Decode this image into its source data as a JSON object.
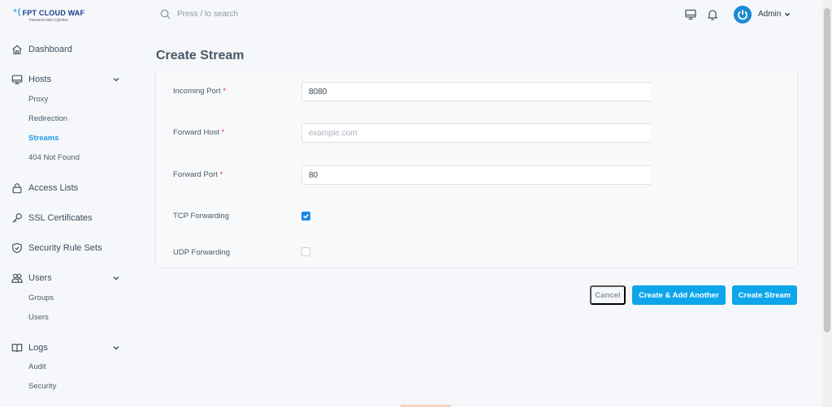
{
  "brand": {
    "name": "FPT CLOUD  WAF",
    "tagline": "Partnered with Cyberlex"
  },
  "header": {
    "search_placeholder": "Press / to search",
    "user_name": "Admin"
  },
  "sidebar": {
    "dashboard": "Dashboard",
    "hosts": {
      "label": "Hosts",
      "items": [
        "Proxy",
        "Redirection",
        "Streams",
        "404 Not Found"
      ]
    },
    "access_lists": "Access Lists",
    "ssl": "SSL Certificates",
    "security_rules": "Security Rule Sets",
    "users": {
      "label": "Users",
      "items": [
        "Groups",
        "Users"
      ]
    },
    "logs": {
      "label": "Logs",
      "items": [
        "Audit",
        "Security"
      ]
    }
  },
  "page": {
    "title": "Create Stream"
  },
  "form": {
    "incoming_port": {
      "label": "Incoming Port",
      "value": "8080"
    },
    "forward_host": {
      "label": "Forward Host",
      "value": "",
      "placeholder": "example.com"
    },
    "forward_port": {
      "label": "Forward Port",
      "value": "80"
    },
    "tcp": {
      "label": "TCP Forwarding",
      "checked": true
    },
    "udp": {
      "label": "UDP Forwarding",
      "checked": false
    },
    "required_mark": "*"
  },
  "actions": {
    "cancel": "Cancel",
    "create_add": "Create & Add Another",
    "create": "Create Stream"
  },
  "colors": {
    "accent": "#0da6ea",
    "active_nav": "#1e9be9",
    "required": "#e53935"
  }
}
